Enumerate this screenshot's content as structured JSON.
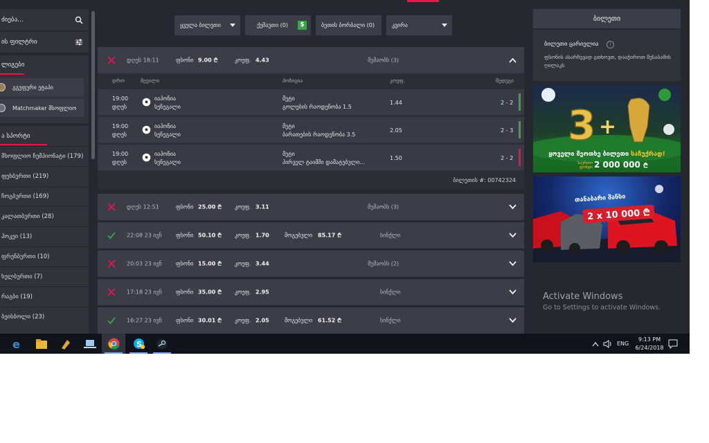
{
  "sidebar": {
    "search_label": "ძიება...",
    "filter_label": "ის ფილტრი",
    "leagues_title": "ლიგები",
    "leagues": [
      "გგუფური ეტაპი",
      "Matchmaker მსოფლიო"
    ],
    "sports_title": "ა სპორტი",
    "sports": [
      "მსოფლიო ჩემპიონატი (179)",
      "ფეხბურთი (219)",
      "ჩოგბურთი (169)",
      "კალათბურთი (28)",
      "ჰოკეი (13)",
      "ფრენბურთი (10)",
      "ხელბურთი (7)",
      "რაგბი (19)",
      "ბეისბოლი (23)"
    ]
  },
  "filters": {
    "all_tickets": "ყველა ბილეთი",
    "cashout": "ქეშაუთი (0)",
    "ticket_borrow": "ბეთის ბორბალი (0)",
    "week": "კვირა"
  },
  "expanded_ticket": {
    "date_label": "დღეს 18:11",
    "stake_label": "ფსონი",
    "stake": "9.00 ₾",
    "coef_label": "კოეფ.",
    "coef": "4.43",
    "status": "მუშაობს (3)",
    "headers": {
      "time": "დრო",
      "event": "მეეილი",
      "position": "პოზიცია",
      "coef": "კოეფ.",
      "result": "შედეგი"
    },
    "bets": [
      {
        "time": "19:00",
        "day": "დღეს",
        "team1": "იაპონია",
        "team2": "სენეგალი",
        "market": "მეტი",
        "selection": "გოლების რაოდენობა 1.5",
        "coef": "1.44",
        "score": "2 - 2",
        "result": "win"
      },
      {
        "time": "19:00",
        "day": "დღეს",
        "team1": "იაპონია",
        "team2": "სენეგალი",
        "market": "მეტი",
        "selection": "ბარათების რაოდენობა 3.5",
        "coef": "2.05",
        "score": "2 - 3",
        "result": "win"
      },
      {
        "time": "19:00",
        "day": "დღეს",
        "team1": "იაპონია",
        "team2": "სენეგალი",
        "market": "მეტი",
        "selection": "პირველ ტაიმში დამატებული...",
        "coef": "1.50",
        "score": "2 - 2",
        "result": "lose"
      }
    ],
    "ticket_number": "ბილეთის #: 00742324"
  },
  "tickets": [
    {
      "status_type": "lost",
      "date": "დღეს 12:51",
      "stake_label": "ფსონი",
      "stake": "25.00 ₾",
      "coef_label": "კოეფ.",
      "coef": "3.11",
      "win_label": "",
      "win": "",
      "status": "მუშაობს (3)"
    },
    {
      "status_type": "won",
      "date": "22:08 23 ივნ",
      "stake_label": "ფსონი",
      "stake": "50.10 ₾",
      "coef_label": "კოეფ.",
      "coef": "1.70",
      "win_label": "მოგებული",
      "win": "85.17 ₾",
      "status": "სინქლი"
    },
    {
      "status_type": "lost",
      "date": "20:03 23 ივნ",
      "stake_label": "ფსონი",
      "stake": "15.00 ₾",
      "coef_label": "კოეფ.",
      "coef": "3.44",
      "win_label": "",
      "win": "",
      "status": "მუშაობს (2)"
    },
    {
      "status_type": "lost",
      "date": "17:18 23 ივნ",
      "stake_label": "ფსონი",
      "stake": "35.00 ₾",
      "coef_label": "კოეფ.",
      "coef": "2.95",
      "win_label": "",
      "win": "",
      "status": "სინქლი"
    },
    {
      "status_type": "won",
      "date": "16:27 23 ივნ",
      "stake_label": "ფსონი",
      "stake": "30.01 ₾",
      "coef_label": "კოეფ.",
      "coef": "2.05",
      "win_label": "მოგებული",
      "win": "61.52 ₾",
      "status": "სინქლი"
    }
  ],
  "betslip": {
    "title": "ბილეთი",
    "empty_title": "ბილეთი ცარიელია",
    "empty_desc": "ფსონის ასარჩევად გთხოვთ, დააჭიროთ შესაბამის ღილაკს"
  },
  "banners": {
    "b1_promo": "ყოველი მეოთხე ბილეთი",
    "b1_promo_free": "საჩუქრად!",
    "b1_jackpot_label": "საერთო ფონდი",
    "b1_jackpot": "2 000 000",
    "b1_currency": "₾",
    "b2_title": "თანაბარი შანსი",
    "b2_badge": "2 x 10 000 ₾"
  },
  "watermark": {
    "title": "Activate Windows",
    "subtitle": "Go to Settings to activate Windows."
  },
  "taskbar": {
    "lang": "ENG",
    "time": "9:13 PM",
    "date": "6/24/2018"
  },
  "colors": {
    "accent": "#e5174a",
    "win": "#3aa546",
    "lose": "#e5174a",
    "panel": "#3c3e47",
    "background": "#26282f"
  }
}
